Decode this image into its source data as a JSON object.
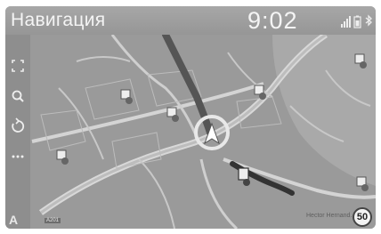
{
  "header": {
    "title": "Навигация",
    "clock": "9:02",
    "status_icons": [
      "signal-icon",
      "battery-icon",
      "bluetooth-icon"
    ]
  },
  "sidebar": {
    "buttons": [
      "fullscreen-icon",
      "search-icon",
      "reroute-icon",
      "more-icon"
    ]
  },
  "map": {
    "road_labels": {
      "hector": "Hector Hernand...",
      "a201": "A201"
    },
    "speed_limit": "50",
    "compass_letter": "A"
  },
  "colors": {
    "map_background": "#9a9a9a",
    "route": "#3a3a3a",
    "roads": "#d8d8d8"
  }
}
